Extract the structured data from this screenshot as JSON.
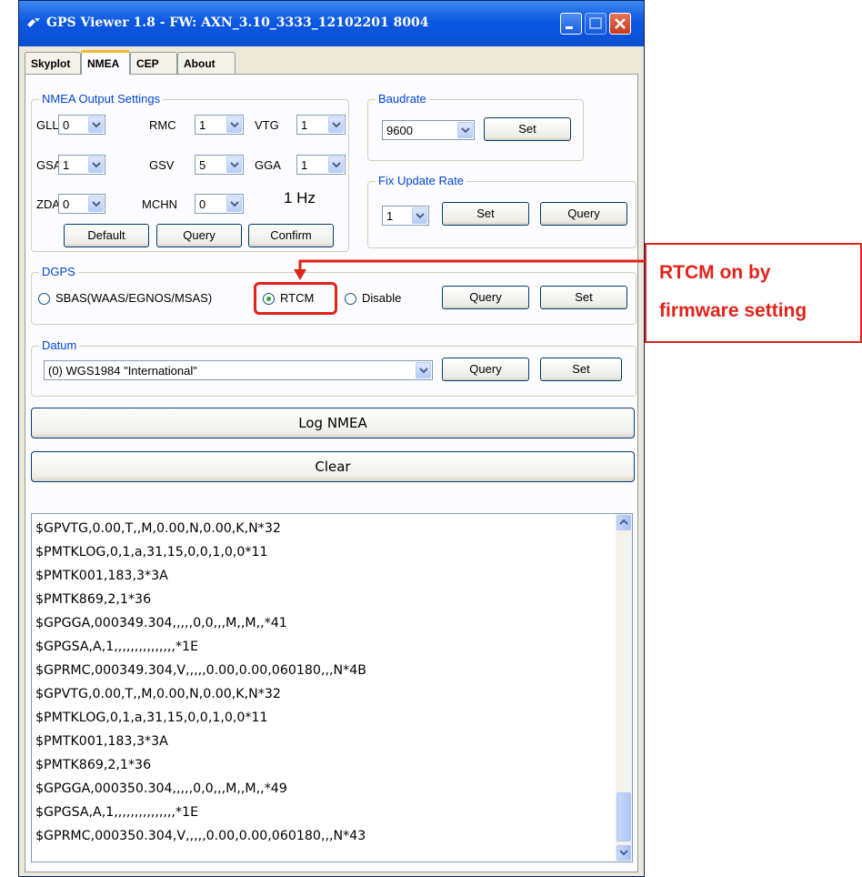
{
  "window": {
    "title": "GPS Viewer 1.8 - FW: AXN_3.10_3333_12102201 8004"
  },
  "tabs": [
    "Skyplot",
    "NMEA",
    "CEP",
    "About"
  ],
  "nmea_output": {
    "title": "NMEA Output Settings",
    "fields": [
      {
        "label": "GLL",
        "value": "0"
      },
      {
        "label": "RMC",
        "value": "1"
      },
      {
        "label": "VTG",
        "value": "1"
      },
      {
        "label": "GSA",
        "value": "1"
      },
      {
        "label": "GSV",
        "value": "5"
      },
      {
        "label": "GGA",
        "value": "1"
      },
      {
        "label": "ZDA",
        "value": "0"
      },
      {
        "label": "MCHN",
        "value": "0"
      }
    ],
    "rate": "1 Hz",
    "buttons": {
      "default": "Default",
      "query": "Query",
      "confirm": "Confirm"
    }
  },
  "baudrate": {
    "title": "Baudrate",
    "value": "9600",
    "set": "Set"
  },
  "fix_update": {
    "title": "Fix Update Rate",
    "value": "1",
    "set": "Set",
    "query": "Query"
  },
  "dgps": {
    "title": "DGPS",
    "options": [
      "SBAS(WAAS/EGNOS/MSAS)",
      "RTCM",
      "Disable"
    ],
    "selected": "RTCM",
    "query": "Query",
    "set": "Set"
  },
  "datum": {
    "title": "Datum",
    "value": "(0) WGS1984 \"International\"",
    "query": "Query",
    "set": "Set"
  },
  "actions": {
    "log": "Log NMEA",
    "clear": "Clear"
  },
  "log_lines": [
    "$GPVTG,0.00,T,,M,0.00,N,0.00,K,N*32",
    "$PMTKLOG,0,1,a,31,15,0,0,1,0,0*11",
    "$PMTK001,183,3*3A",
    "$PMTK869,2,1*36",
    "$GPGGA,000349.304,,,,,0,0,,,M,,M,,*41",
    "$GPGSA,A,1,,,,,,,,,,,,,,,*1E",
    "$GPRMC,000349.304,V,,,,,0.00,0.00,060180,,,N*4B",
    "$GPVTG,0.00,T,,M,0.00,N,0.00,K,N*32",
    "$PMTKLOG,0,1,a,31,15,0,0,1,0,0*11",
    "$PMTK001,183,3*3A",
    "$PMTK869,2,1*36",
    "$GPGGA,000350.304,,,,,0,0,,,M,,M,,*49",
    "$GPGSA,A,1,,,,,,,,,,,,,,,*1E",
    "$GPRMC,000350.304,V,,,,,0.00,0.00,060180,,,N*43"
  ],
  "annotation": {
    "line1": "RTCM on by",
    "line2": "firmware setting",
    "color": "#e0241b"
  },
  "colors": {
    "titlebar": "#0c58e2",
    "group_label": "#0046d5",
    "accent_tab": "#f9b337"
  }
}
